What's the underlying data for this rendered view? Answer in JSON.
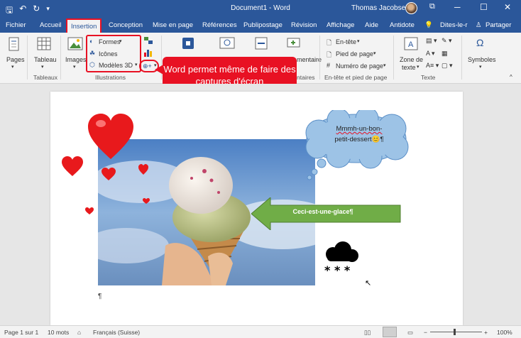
{
  "titlebar": {
    "document_title": "Document1  -  Word",
    "user_name": "Thomas Jacobsen",
    "icons": [
      "save-icon",
      "undo-icon",
      "redo-icon",
      "customize-icon"
    ]
  },
  "tabs": [
    "Fichier",
    "Accueil",
    "Insertion",
    "Conception",
    "Mise en page",
    "Références",
    "Publipostage",
    "Révision",
    "Affichage",
    "Aide",
    "Antidote"
  ],
  "active_tab": "Insertion",
  "tell_me": "Dites-le-r",
  "share": "Partager",
  "ribbon": {
    "pages": "Pages",
    "tableau": "Tableau",
    "images": "Images",
    "formes": "Formes",
    "icones": "Icônes",
    "modeles3d": "Modèles 3D",
    "commentaire": "mentaire",
    "entete": "En-tête",
    "pied": "Pied de page",
    "numero": "Numéro de page",
    "zone_line1": "Zone de",
    "zone_line2": "texte",
    "symboles": "Symboles",
    "group_tableaux": "Tableaux",
    "group_illustrations": "Illustrations",
    "group_commentaires": "ntaires",
    "group_entete": "En-tête et pied de page",
    "group_texte": "Texte"
  },
  "callout_text": "Word permet même de faire des captures d'écran",
  "document": {
    "bubble_line1": "Mmmh-un-bon-",
    "bubble_line2": "petit-dessert",
    "bubble_emoji": "😊",
    "bubble_pilcrow": "¶",
    "arrow_text": "Ceci-est-une-glace¶",
    "pilcrow": "¶"
  },
  "status": {
    "page": "Page 1 sur 1",
    "words": "10 mots",
    "language": "Français (Suisse)",
    "zoom": "100%"
  },
  "colors": {
    "word_blue": "#2b579a",
    "highlight_red": "#e81123",
    "arrow_green": "#70ad47",
    "bubble_blue": "#9dc3e6"
  }
}
